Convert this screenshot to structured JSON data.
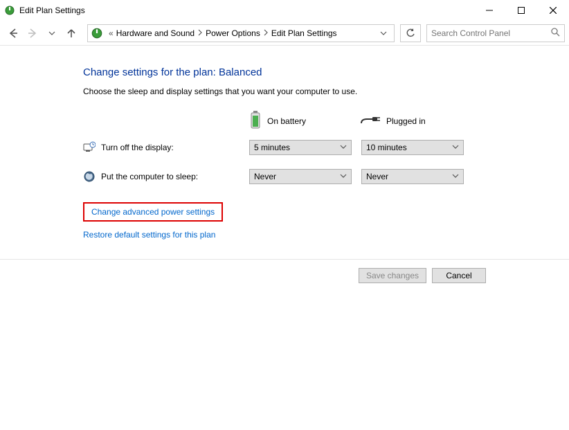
{
  "window": {
    "title": "Edit Plan Settings"
  },
  "breadcrumb": {
    "prefix": "«",
    "items": [
      "Hardware and Sound",
      "Power Options",
      "Edit Plan Settings"
    ]
  },
  "search": {
    "placeholder": "Search Control Panel"
  },
  "main": {
    "heading": "Change settings for the plan: Balanced",
    "description": "Choose the sleep and display settings that you want your computer to use.",
    "columns": {
      "battery": "On battery",
      "plugged": "Plugged in"
    },
    "rows": [
      {
        "label": "Turn off the display:",
        "battery": "5 minutes",
        "plugged": "10 minutes"
      },
      {
        "label": "Put the computer to sleep:",
        "battery": "Never",
        "plugged": "Never"
      }
    ],
    "links": {
      "advanced": "Change advanced power settings",
      "restore": "Restore default settings for this plan"
    }
  },
  "footer": {
    "save": "Save changes",
    "cancel": "Cancel"
  }
}
